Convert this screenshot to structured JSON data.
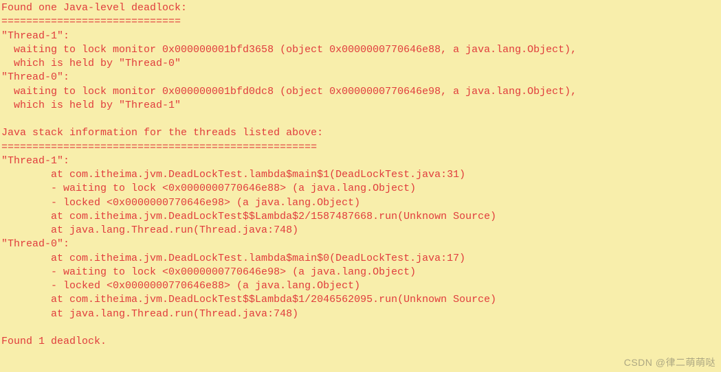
{
  "lines": [
    "Found one Java-level deadlock:",
    "=============================",
    "\"Thread-1\":",
    "  waiting to lock monitor 0x000000001bfd3658 (object 0x0000000770646e88, a java.lang.Object),",
    "  which is held by \"Thread-0\"",
    "\"Thread-0\":",
    "  waiting to lock monitor 0x000000001bfd0dc8 (object 0x0000000770646e98, a java.lang.Object),",
    "  which is held by \"Thread-1\"",
    "",
    "Java stack information for the threads listed above:",
    "===================================================",
    "\"Thread-1\":",
    "        at com.itheima.jvm.DeadLockTest.lambda$main$1(DeadLockTest.java:31)",
    "        - waiting to lock <0x0000000770646e88> (a java.lang.Object)",
    "        - locked <0x0000000770646e98> (a java.lang.Object)",
    "        at com.itheima.jvm.DeadLockTest$$Lambda$2/1587487668.run(Unknown Source)",
    "        at java.lang.Thread.run(Thread.java:748)",
    "\"Thread-0\":",
    "        at com.itheima.jvm.DeadLockTest.lambda$main$0(DeadLockTest.java:17)",
    "        - waiting to lock <0x0000000770646e98> (a java.lang.Object)",
    "        - locked <0x0000000770646e88> (a java.lang.Object)",
    "        at com.itheima.jvm.DeadLockTest$$Lambda$1/2046562095.run(Unknown Source)",
    "        at java.lang.Thread.run(Thread.java:748)",
    "",
    "Found 1 deadlock."
  ],
  "watermark": "CSDN @律二萌萌哒"
}
